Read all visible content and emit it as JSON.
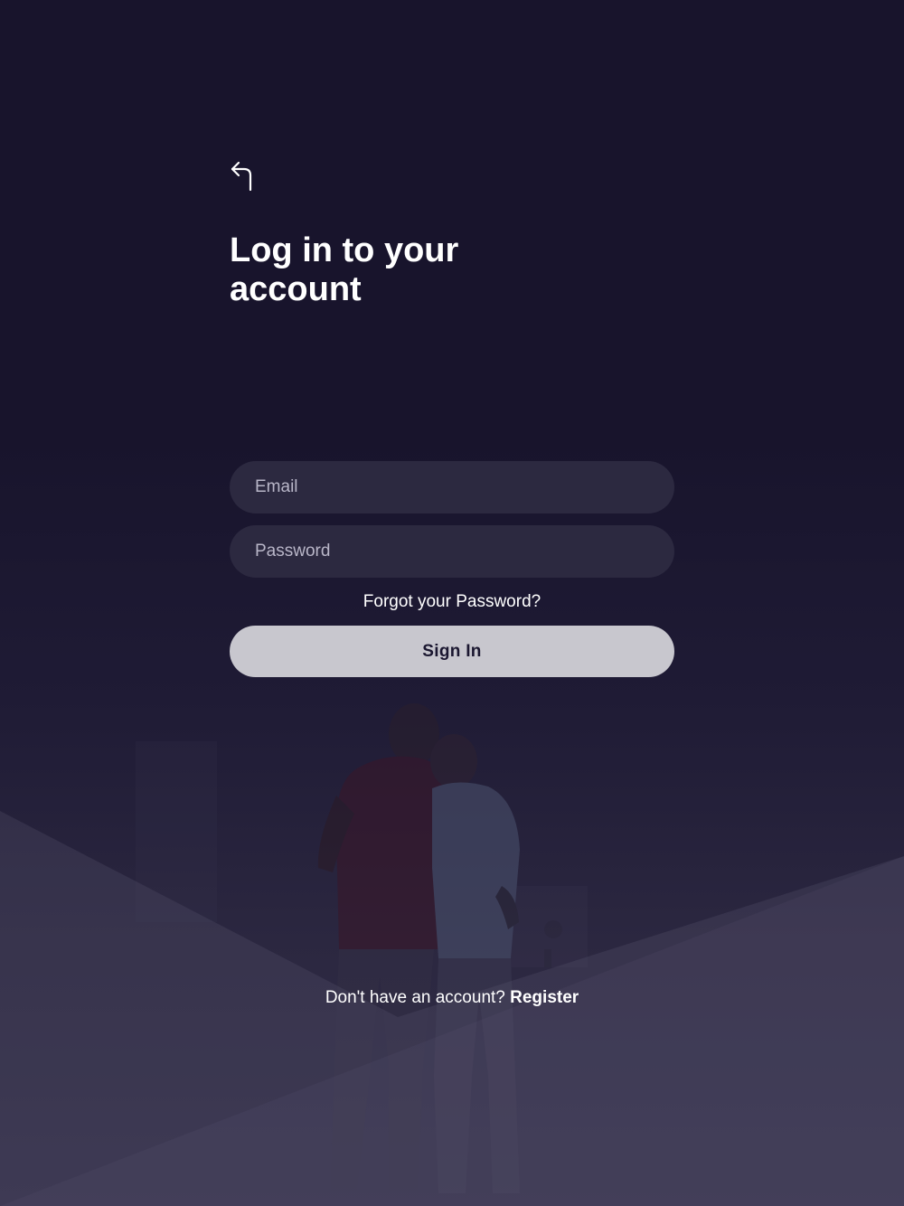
{
  "header": {
    "back_icon": "back-arrow-icon",
    "title": "Log in to your account"
  },
  "form": {
    "email_placeholder": "Email",
    "email_value": "",
    "password_placeholder": "Password",
    "password_value": "",
    "forgot_password": "Forgot your Password?",
    "signin_label": "Sign In"
  },
  "footer": {
    "prompt": "Don't have an account? ",
    "register_label": "Register"
  },
  "colors": {
    "background": "#18142c",
    "input_background": "#2c2940",
    "button_background": "#c8c7ce",
    "button_text": "#1b1730",
    "text": "#ffffff",
    "placeholder": "#b9b6c8"
  }
}
